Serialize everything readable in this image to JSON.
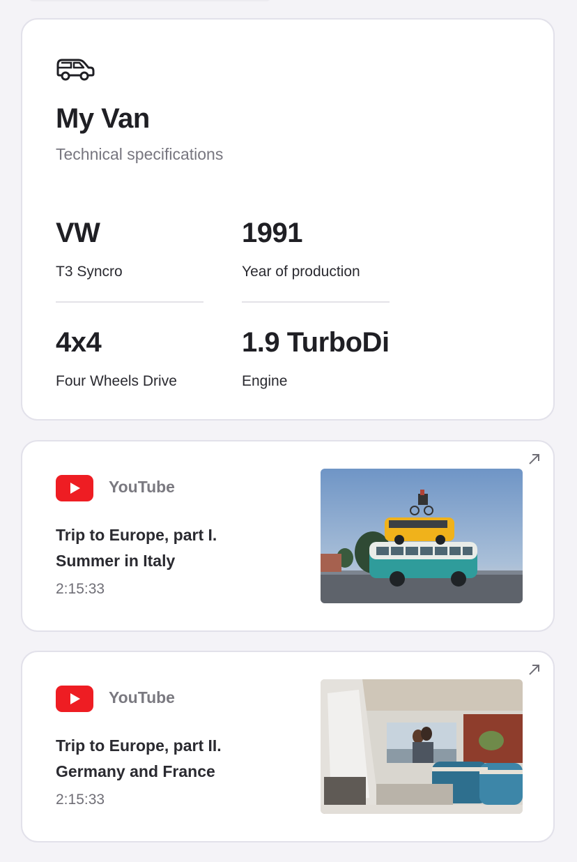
{
  "spec_card": {
    "icon": "van-icon",
    "title": "My Van",
    "subtitle": "Technical specifications",
    "specs": [
      {
        "value": "VW",
        "label": "T3 Syncro"
      },
      {
        "value": "1991",
        "label": "Year of production"
      },
      {
        "value": "4x4",
        "label": "Four Wheels Drive"
      },
      {
        "value": "1.9 TurboDi",
        "label": "Engine"
      }
    ]
  },
  "videos": [
    {
      "source": "YouTube",
      "title_line1": "Trip to Europe, part I.",
      "title_line2": "Summer in Italy",
      "duration": "2:15:33",
      "thumbnail": "two vans stacked, teal bus with yellow van on top"
    },
    {
      "source": "YouTube",
      "title_line1": "Trip to Europe, part II.",
      "title_line2": "Germany and France",
      "duration": "2:15:33",
      "thumbnail": "couple seen through van interior"
    }
  ],
  "colors": {
    "background": "#f4f3f7",
    "card": "#ffffff",
    "card_border": "#e2e1ea",
    "youtube_red": "#ee1d23",
    "muted_text": "#77767f"
  }
}
